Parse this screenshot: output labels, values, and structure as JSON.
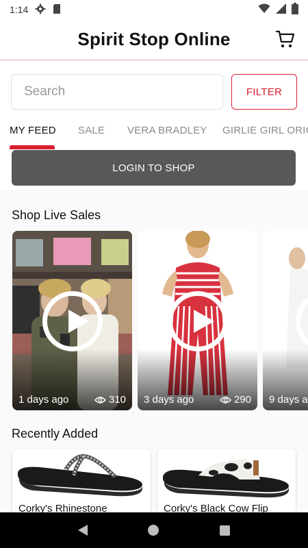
{
  "status_bar": {
    "time": "1:14"
  },
  "header": {
    "title": "Spirit Stop Online"
  },
  "search": {
    "placeholder": "Search",
    "filter_label": "FILTER"
  },
  "tabs": [
    {
      "label": "MY FEED",
      "active": true
    },
    {
      "label": "SALE"
    },
    {
      "label": "VERA BRADLEY"
    },
    {
      "label": "GIRLIE GIRL ORIG"
    }
  ],
  "login": {
    "label": "LOGIN TO SHOP"
  },
  "live_sales": {
    "title": "Shop Live Sales",
    "cards": [
      {
        "date": "1 days ago",
        "views": "310"
      },
      {
        "date": "3 days ago",
        "views": "290"
      },
      {
        "date": "9 days a",
        "views": ""
      }
    ]
  },
  "recently_added": {
    "title": "Recently Added",
    "items": [
      {
        "name": "Corky's Rhinestone"
      },
      {
        "name": "Corky's Black Cow Flip"
      }
    ]
  },
  "colors": {
    "accent": "#d9202e",
    "login_bg": "#585858",
    "header_divider": "#e8a7ac"
  },
  "icons": [
    "gear-icon",
    "sd-card-icon",
    "wifi-icon",
    "signal-icon",
    "battery-icon",
    "cart-icon",
    "play-icon",
    "eye-icon",
    "back-icon",
    "home-icon",
    "recents-icon"
  ]
}
